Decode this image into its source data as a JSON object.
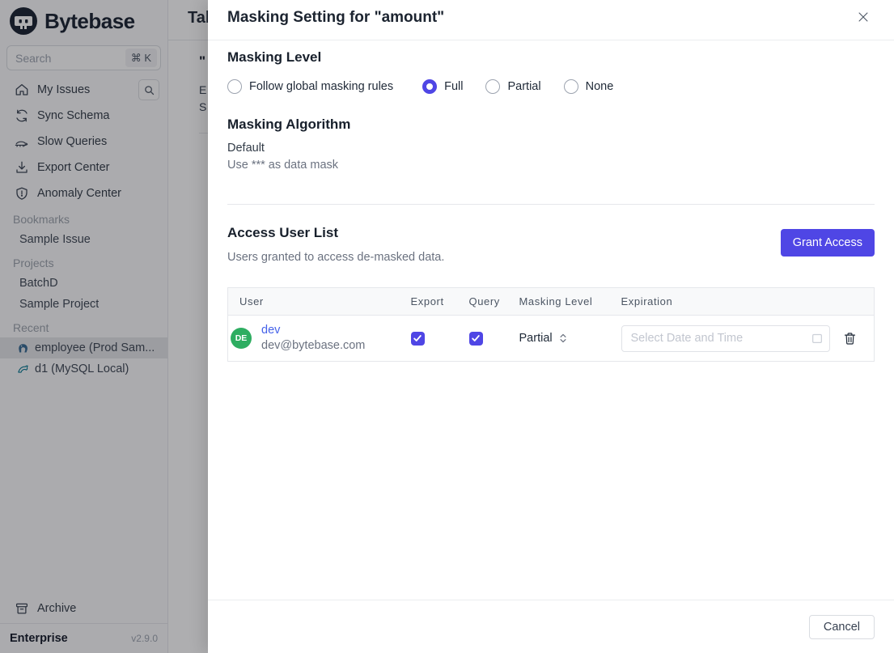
{
  "sidebar": {
    "logo_text": "Bytebase",
    "search": {
      "placeholder": "Search",
      "shortcut": "⌘ K"
    },
    "nav": [
      {
        "label": "My Issues"
      },
      {
        "label": "Sync Schema"
      },
      {
        "label": "Slow Queries"
      },
      {
        "label": "Export Center"
      },
      {
        "label": "Anomaly Center"
      }
    ],
    "sections": {
      "bookmarks": {
        "label": "Bookmarks",
        "items": [
          {
            "label": "Sample Issue"
          }
        ]
      },
      "projects": {
        "label": "Projects",
        "items": [
          {
            "label": "BatchD"
          },
          {
            "label": "Sample Project"
          }
        ]
      },
      "recent": {
        "label": "Recent",
        "items": [
          {
            "label": "employee (Prod Sam...",
            "db": "postgres",
            "selected": true
          },
          {
            "label": "d1 (MySQL Local)",
            "db": "mysql",
            "selected": false
          }
        ]
      }
    },
    "archive_label": "Archive",
    "footer": {
      "plan": "Enterprise",
      "version": "v2.9.0"
    }
  },
  "background_page": {
    "heading_fragment": "Tab",
    "quote_fragment": "\"",
    "line_fragment_1": "E",
    "line_fragment_2": "S"
  },
  "modal": {
    "title": "Masking Setting for \"amount\"",
    "masking_level": {
      "heading": "Masking Level",
      "options": [
        {
          "label": "Follow global masking rules",
          "selected": false
        },
        {
          "label": "Full",
          "selected": true
        },
        {
          "label": "Partial",
          "selected": false
        },
        {
          "label": "None",
          "selected": false
        }
      ]
    },
    "masking_algorithm": {
      "heading": "Masking Algorithm",
      "name": "Default",
      "description": "Use *** as data mask"
    },
    "access_user_list": {
      "heading": "Access User List",
      "subtitle": "Users granted to access de-masked data.",
      "grant_button_label": "Grant Access",
      "table": {
        "columns": [
          "User",
          "Export",
          "Query",
          "Masking Level",
          "Expiration"
        ],
        "rows": [
          {
            "avatar_initials": "DE",
            "name": "dev",
            "email": "dev@bytebase.com",
            "export_checked": true,
            "query_checked": true,
            "masking_level": "Partial",
            "expiration_placeholder": "Select Date and Time"
          }
        ]
      }
    },
    "footer": {
      "cancel_label": "Cancel"
    }
  },
  "colors": {
    "accent": "#4f46e5",
    "link": "#4562e9",
    "avatar_green": "#2ead61",
    "backdrop": "rgba(22,24,29,0.35)"
  }
}
